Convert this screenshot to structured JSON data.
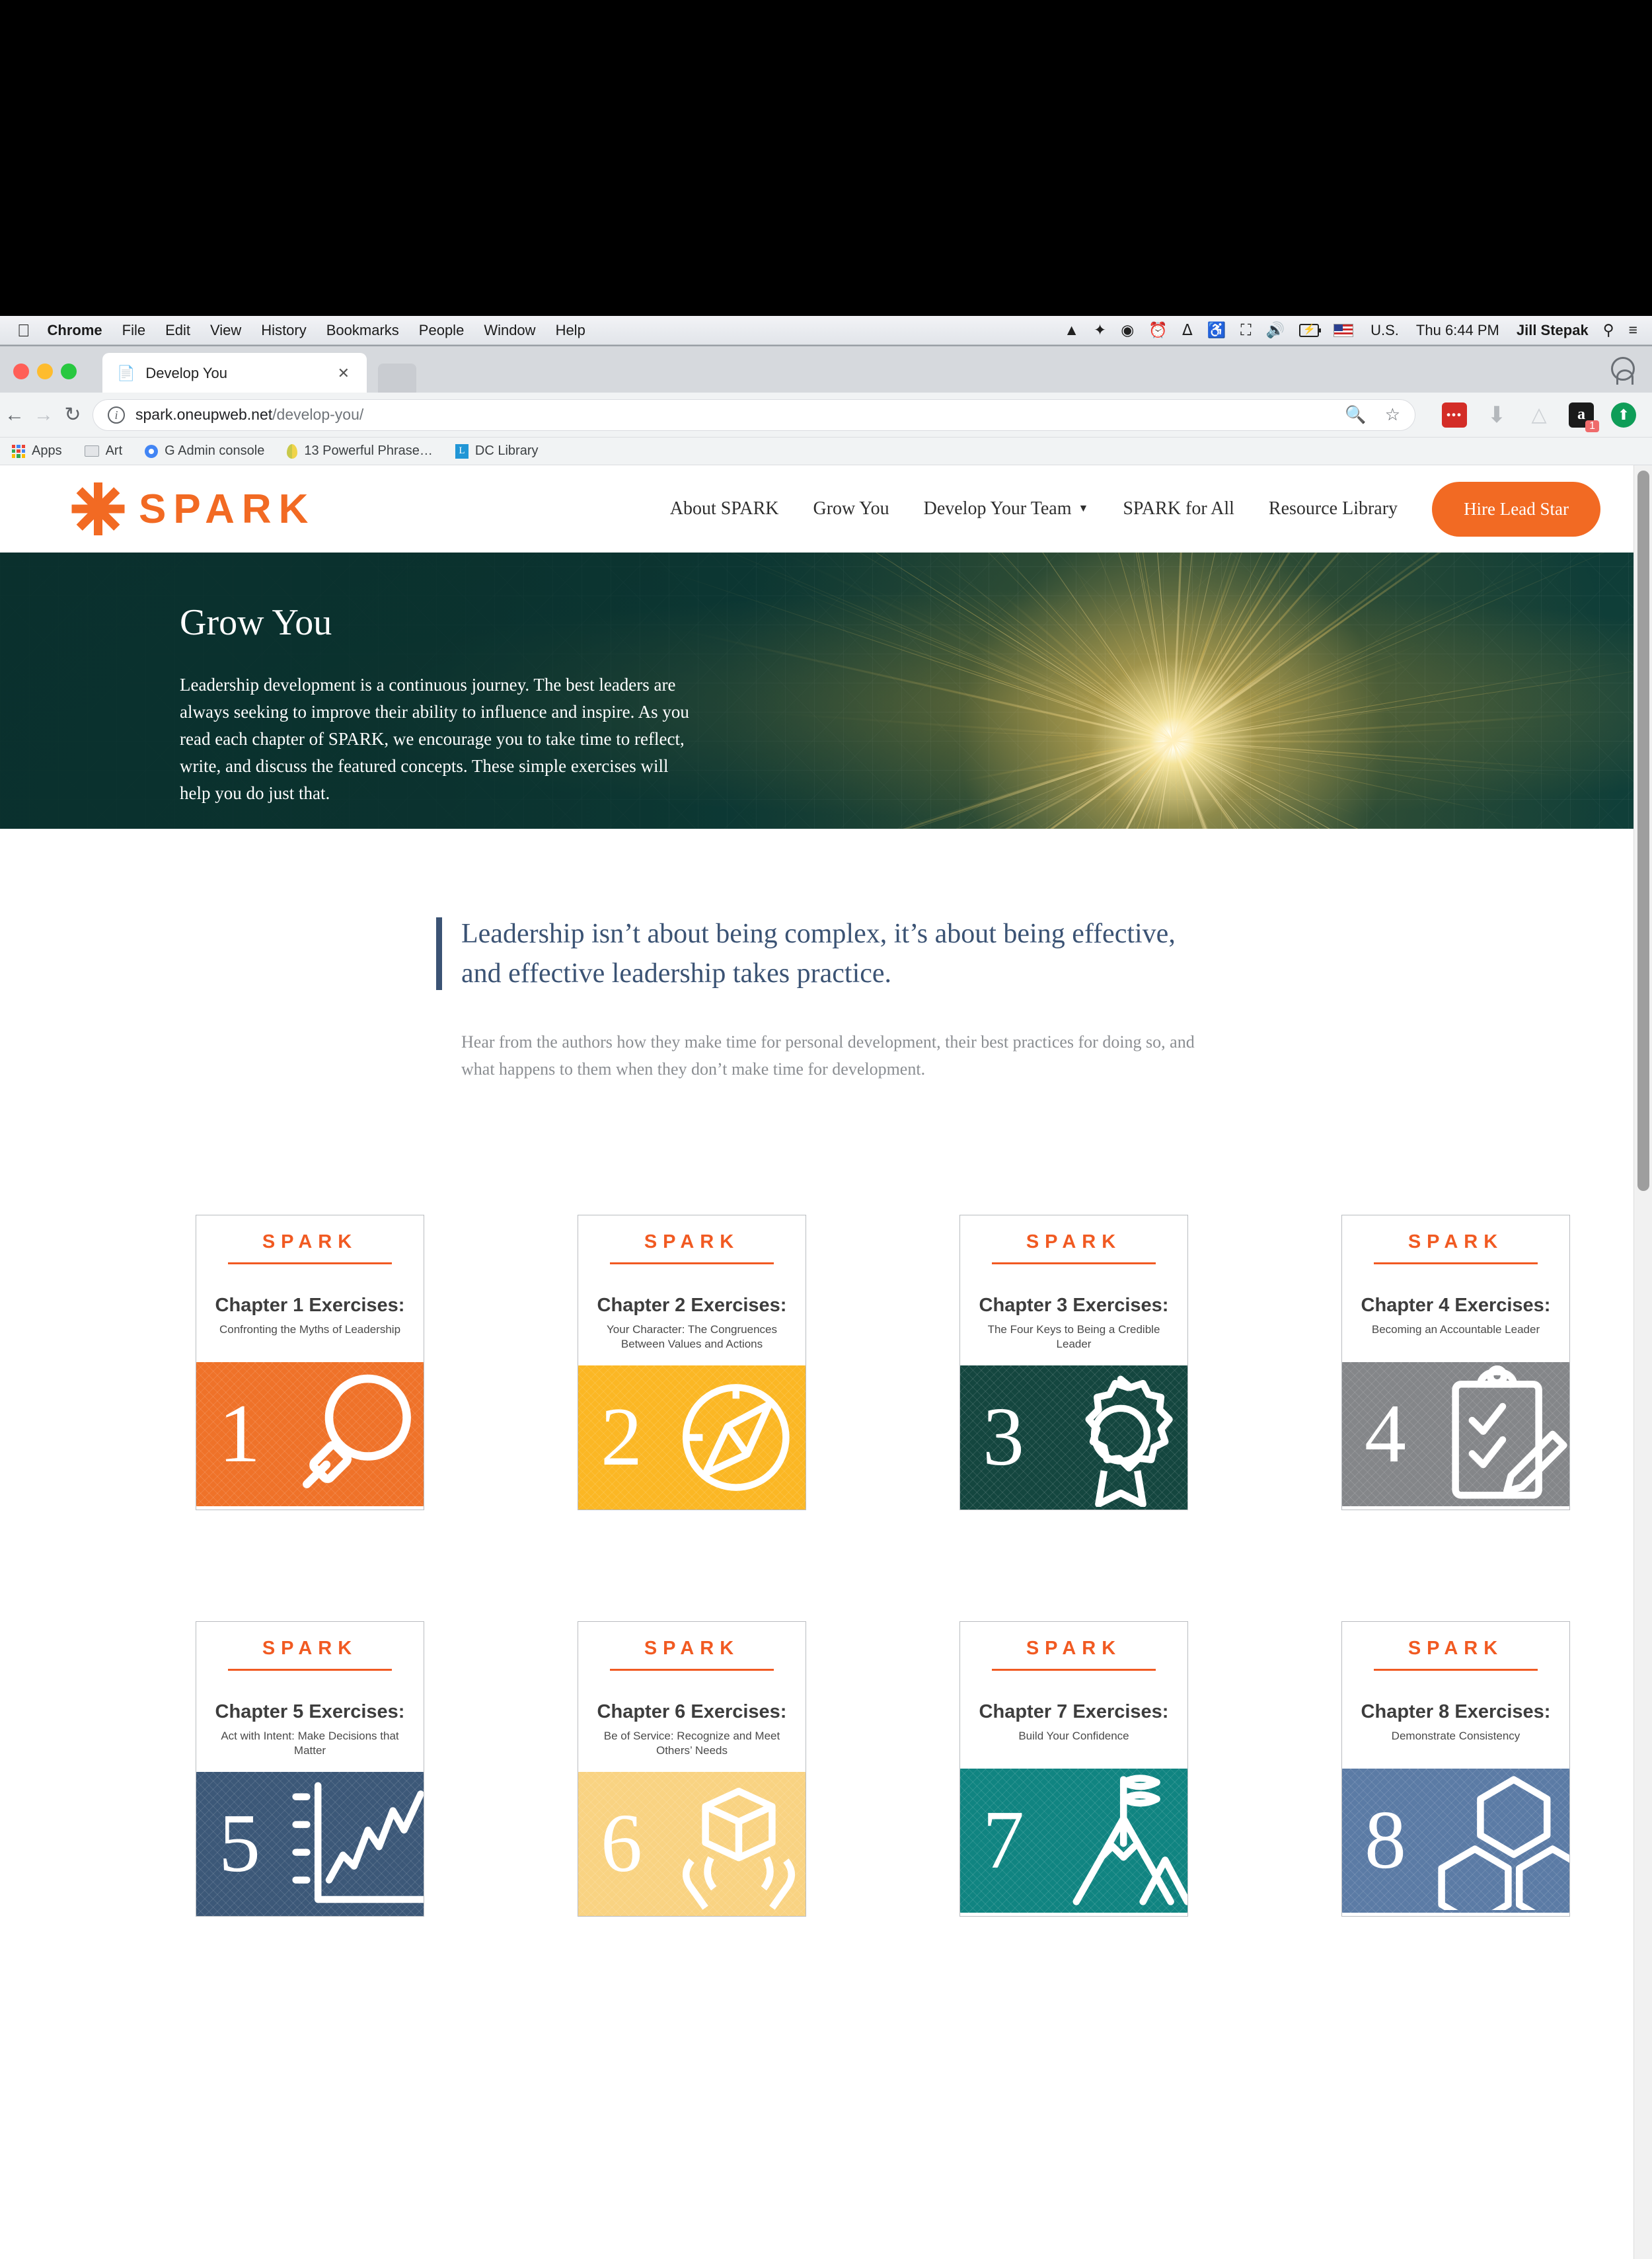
{
  "os": {
    "menu_items": [
      "Chrome",
      "File",
      "Edit",
      "View",
      "History",
      "Bookmarks",
      "People",
      "Window",
      "Help"
    ],
    "status_icons": [
      "dropbox-alt-icon",
      "dropbox-icon",
      "evernote-icon",
      "time-machine-icon",
      "bluetooth-icon",
      "wifi-icon",
      "airplay-icon",
      "volume-icon",
      "battery-charging-icon"
    ],
    "input_source": "U.S.",
    "clock": "Thu 6:44 PM",
    "user": "Jill Stepak",
    "right_icons": [
      "spotlight-search-icon",
      "notification-center-icon"
    ]
  },
  "browser": {
    "tab_title": "Develop You",
    "url_host": "spark.oneupweb.net",
    "url_path": "/develop-you/",
    "nav_icons": [
      "back-arrow-icon",
      "forward-arrow-icon",
      "reload-icon"
    ],
    "omnibox_icons": [
      "page-info-icon",
      "zoom-out-icon",
      "bookmark-star-icon"
    ],
    "extensions": [
      {
        "name": "lastpass-extension-icon",
        "label": "•••"
      },
      {
        "name": "download-extension-icon",
        "label": ""
      },
      {
        "name": "google-drive-extension-icon",
        "label": ""
      },
      {
        "name": "amazon-extension-icon",
        "label": "a",
        "badge": "1"
      },
      {
        "name": "upload-extension-icon",
        "label": ""
      }
    ],
    "bookmarks": [
      "Apps",
      "Art",
      "G Admin console",
      "13 Powerful Phrase…",
      "DC Library"
    ]
  },
  "site": {
    "logo_text": "SPARK",
    "nav": [
      {
        "label": "About SPARK",
        "has_caret": false
      },
      {
        "label": "Grow You",
        "has_caret": false
      },
      {
        "label": "Develop Your Team",
        "has_caret": true
      },
      {
        "label": "SPARK for All",
        "has_caret": false
      },
      {
        "label": "Resource Library",
        "has_caret": false
      }
    ],
    "cta_label": "Hire Lead Star",
    "accent_orange": "#f26a23",
    "hero": {
      "title": "Grow You",
      "body": "Leadership development is a continuous journey. The best leaders are always seeking to improve their ability to influence and inspire. As you read each chapter of SPARK, we encourage you to take time to reflect, write, and discuss the featured concepts. These simple exercises will help you do just that."
    },
    "quote": {
      "headline": "Leadership isn’t about being complex, it’s about being effective, and effective leadership takes practice.",
      "subtext": "Hear from the authors how they make time for personal development, their best practices for doing so, and what happens to them when they don’t make time for development.",
      "accent": "#3b5374"
    },
    "cards_brand": "SPARK",
    "cards": [
      {
        "title": "Chapter 1 Exercises:",
        "subtitle": "Confronting the Myths of Leadership",
        "number": "1",
        "color": "#ef7229",
        "icon": "magnifier-icon"
      },
      {
        "title": "Chapter 2 Exercises:",
        "subtitle": "Your Character: The Congruences Between Values and Actions",
        "number": "2",
        "color": "#fbb724",
        "icon": "compass-icon"
      },
      {
        "title": "Chapter 3 Exercises:",
        "subtitle": "The Four Keys to Being a Credible Leader",
        "number": "3",
        "color": "#14463f",
        "icon": "award-ribbon-icon"
      },
      {
        "title": "Chapter 4 Exercises:",
        "subtitle": "Becoming an Accountable Leader",
        "number": "4",
        "color": "#848689",
        "icon": "clipboard-checklist-icon"
      },
      {
        "title": "Chapter 5 Exercises:",
        "subtitle": "Act with Intent: Make Decisions that Matter",
        "number": "5",
        "color": "#3c5878",
        "icon": "line-chart-icon"
      },
      {
        "title": "Chapter 6 Exercises:",
        "subtitle": "Be of Service: Recognize and Meet Others’ Needs",
        "number": "6",
        "color": "#f9d382",
        "icon": "hands-holding-cube-icon"
      },
      {
        "title": "Chapter 7 Exercises:",
        "subtitle": "Build Your Confidence",
        "number": "7",
        "color": "#108481",
        "icon": "mountain-flag-icon"
      },
      {
        "title": "Chapter 8 Exercises:",
        "subtitle": "Demonstrate Consistency",
        "number": "8",
        "color": "#5b7ba5",
        "icon": "hexagons-icon"
      }
    ]
  }
}
